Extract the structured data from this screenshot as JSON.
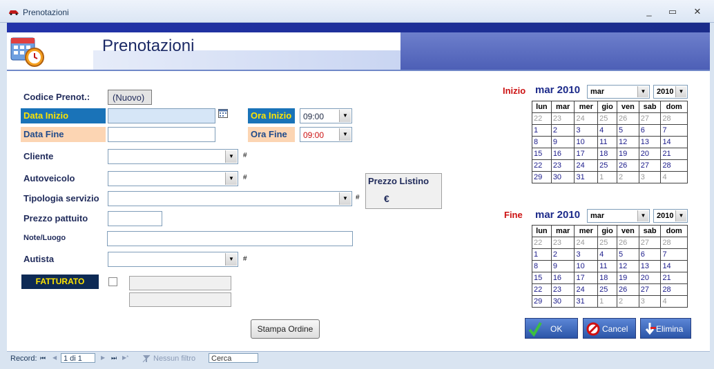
{
  "window": {
    "title": "Prenotazioni",
    "min": "_",
    "max": "▭",
    "close": "✕"
  },
  "header": {
    "title": "Prenotazioni"
  },
  "form": {
    "codice_label": "Codice Prenot.:",
    "codice_value": "(Nuovo)",
    "data_inizio_label": "Data Inizio",
    "data_fine_label": "Data Fine",
    "ora_inizio_label": "Ora Inizio",
    "ora_inizio_value": "09:00",
    "ora_fine_label": "Ora Fine",
    "ora_fine_value": "09:00",
    "cliente_label": "Cliente",
    "autoveicolo_label": "Autoveicolo",
    "tipologia_label": "Tipologia servizio",
    "prezzo_pattuito_label": "Prezzo pattuito",
    "note_label": "Note/Luogo",
    "autista_label": "Autista",
    "fatturato_label": "FATTURATO",
    "prezzo_listino_label": "Prezzo Listino",
    "euro": "€",
    "hash": "#",
    "stampa_label": "Stampa Ordine"
  },
  "cal_start": {
    "label": "Inizio",
    "heading": "mar 2010",
    "month": "mar",
    "year": "2010",
    "days": [
      "lun",
      "mar",
      "mer",
      "gio",
      "ven",
      "sab",
      "dom"
    ],
    "rows": [
      [
        "22",
        "23",
        "24",
        "25",
        "26",
        "27",
        "28"
      ],
      [
        "1",
        "2",
        "3",
        "4",
        "5",
        "6",
        "7"
      ],
      [
        "8",
        "9",
        "10",
        "11",
        "12",
        "13",
        "14"
      ],
      [
        "15",
        "16",
        "17",
        "18",
        "19",
        "20",
        "21"
      ],
      [
        "22",
        "23",
        "24",
        "25",
        "26",
        "27",
        "28"
      ],
      [
        "29",
        "30",
        "31",
        "1",
        "2",
        "3",
        "4"
      ]
    ]
  },
  "cal_end": {
    "label": "Fine",
    "heading": "mar 2010",
    "month": "mar",
    "year": "2010",
    "days": [
      "lun",
      "mar",
      "mer",
      "gio",
      "ven",
      "sab",
      "dom"
    ],
    "rows": [
      [
        "22",
        "23",
        "24",
        "25",
        "26",
        "27",
        "28"
      ],
      [
        "1",
        "2",
        "3",
        "4",
        "5",
        "6",
        "7"
      ],
      [
        "8",
        "9",
        "10",
        "11",
        "12",
        "13",
        "14"
      ],
      [
        "15",
        "16",
        "17",
        "18",
        "19",
        "20",
        "21"
      ],
      [
        "22",
        "23",
        "24",
        "25",
        "26",
        "27",
        "28"
      ],
      [
        "29",
        "30",
        "31",
        "1",
        "2",
        "3",
        "4"
      ]
    ]
  },
  "actions": {
    "ok": "OK",
    "cancel": "Cancel",
    "elimina": "Elimina"
  },
  "nav": {
    "record_label": "Record:",
    "first": "⏮",
    "prev": "◀",
    "position": "1 di 1",
    "next": "▶",
    "last": "⏭",
    "new": "▶*",
    "filter": "Nessun filtro",
    "search": "Cerca"
  },
  "colors": {
    "accent_red": "#cc1111",
    "label_blue": "#1a73b8",
    "label_yellow": "#ffe400",
    "peach": "#fcd5b3",
    "fatturato_bg": "#0d2a55"
  }
}
